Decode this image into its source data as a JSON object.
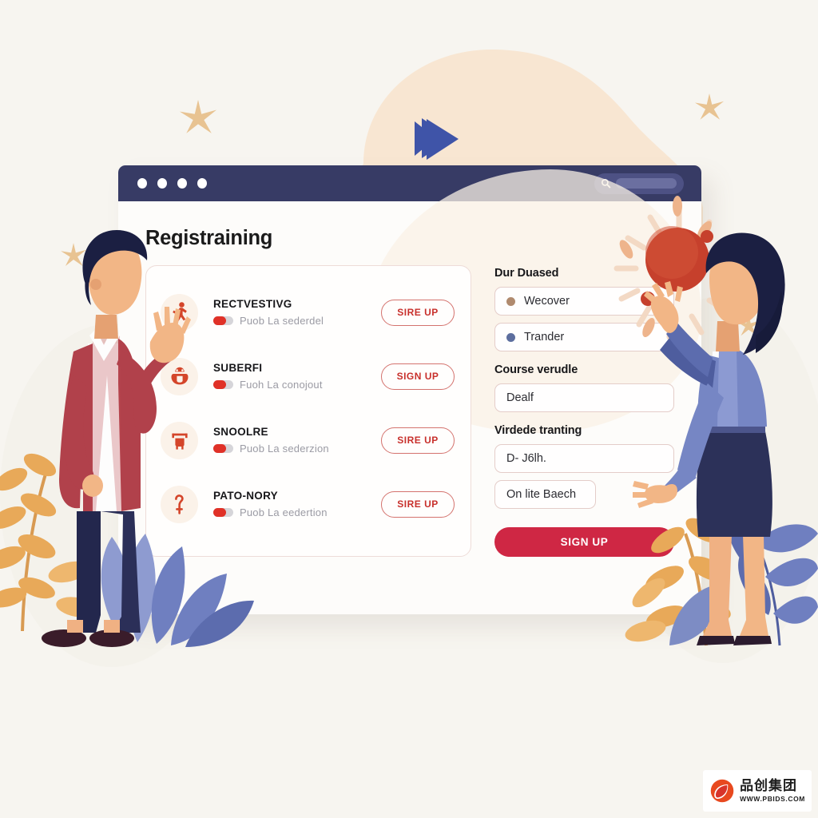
{
  "canvas": {
    "background_color": "#f7f5f0",
    "blob_color": "#f8e6d2"
  },
  "decor": {
    "fastforward_icon": "fast-forward-icon",
    "fastforward_color": "#3f54a8",
    "sun_color": "#c6402c",
    "sparkle_color": "#e8c392",
    "leaf_gold_color": "#e8a959",
    "leaf_blue_color": "#7d8cc4"
  },
  "window": {
    "titlebar": {
      "color": "#373b65",
      "dots": [
        "dot-1",
        "dot-2",
        "dot-3",
        "dot-4"
      ],
      "search": {
        "icon": "search-icon",
        "placeholder": "",
        "value": ""
      }
    },
    "page_title": "Registraining"
  },
  "courses": {
    "items": [
      {
        "icon": "runner-icon",
        "name": "RECTVESTIVG",
        "subtitle": "Puob La sederdel",
        "toggle_on": true,
        "action_label": "SIRE UP"
      },
      {
        "icon": "mask-face-icon",
        "name": "SUBERFI",
        "subtitle": "Fuoh La conojout",
        "toggle_on": true,
        "action_label": "SIGN UP"
      },
      {
        "icon": "bench-icon",
        "name": "SNOOLRE",
        "subtitle": "Puob La sederzion",
        "toggle_on": true,
        "action_label": "SIRE UP"
      },
      {
        "icon": "question-mark-icon",
        "name": "PATO-NORY",
        "subtitle": "Puob La eedertion",
        "toggle_on": true,
        "action_label": "SIRE UP"
      }
    ]
  },
  "form": {
    "group_1": {
      "label": "Dur Duased",
      "options": [
        {
          "label": "Wecover",
          "dot_color": "#b08a6e"
        },
        {
          "label": "Trander",
          "dot_color": "#5d6e9e"
        }
      ]
    },
    "group_2": {
      "label": "Course verudle",
      "value": "Dealf"
    },
    "group_3": {
      "label": "Virdede tranting",
      "value": "D- J6lh.",
      "secondary_value": "On lite Baech"
    },
    "submit_label": "SIGN UP",
    "submit_color": "#cf2744"
  },
  "watermark": {
    "company_cn": "品创集团",
    "url": "WWW.PBIDS.COM",
    "mark": "leaf-logo-icon"
  }
}
